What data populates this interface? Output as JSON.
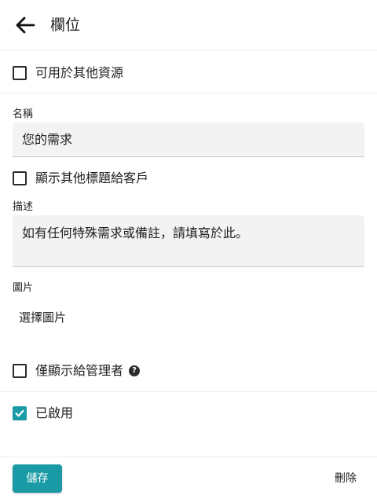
{
  "header": {
    "title": "欄位",
    "back_icon": "arrow-left-icon"
  },
  "available_other_resources": {
    "label": "可用於其他資源",
    "checked": false
  },
  "name_field": {
    "label": "名稱",
    "value": "您的需求"
  },
  "show_other_title": {
    "label": "顯示其他標題給客戶",
    "checked": false
  },
  "description_field": {
    "label": "描述",
    "value": "如有任何特殊需求或備註，請填寫於此。"
  },
  "image_field": {
    "label": "圖片",
    "select_label": "選擇圖片"
  },
  "admin_only": {
    "label": "僅顯示給管理者",
    "checked": false,
    "help_icon": "question-circle-icon"
  },
  "enabled": {
    "label": "已啟用",
    "checked": true
  },
  "footer": {
    "save_label": "儲存",
    "delete_label": "刪除"
  },
  "colors": {
    "accent": "#1a9aa5",
    "input_bg": "#f3f3f3",
    "divider": "#ececec"
  }
}
